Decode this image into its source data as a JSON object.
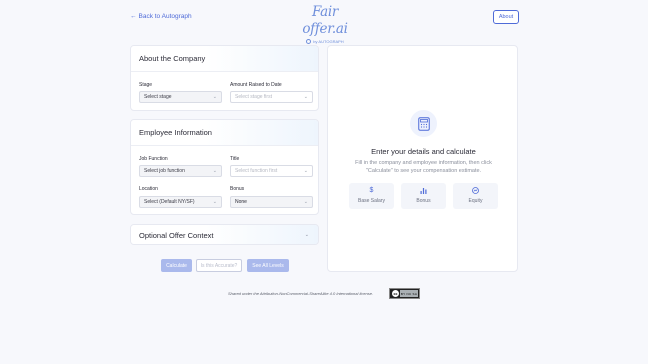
{
  "header": {
    "back_label": "Back to Autograph",
    "logo_text": "Fair offer.ai",
    "logo_sub": "by AUTOGRAPH",
    "about_label": "About"
  },
  "company": {
    "title": "About the Company",
    "stage_label": "Stage",
    "stage_value": "Select stage",
    "amount_label": "Amount Raised to Date",
    "amount_value": "Select stage first"
  },
  "employee": {
    "title": "Employee Information",
    "job_label": "Job Function",
    "job_value": "Select job function",
    "title_label": "Title",
    "title_value": "Select function first",
    "location_label": "Location",
    "location_value": "Select (Default NY/SF)",
    "bonus_label": "Bonus",
    "bonus_value": "None"
  },
  "optional": {
    "title": "Optional Offer Context"
  },
  "actions": {
    "calculate": "Calculate",
    "accurate": "Is this Accurate?",
    "levels": "See All Levels"
  },
  "result": {
    "title": "Enter your details and calculate",
    "description": "Fill in the company and employee information, then click \"Calculate\" to see your compensation estimate.",
    "metrics": [
      {
        "label": "Base Salary",
        "icon": "dollar-icon"
      },
      {
        "label": "Bonus",
        "icon": "bar-chart-icon"
      },
      {
        "label": "Equity",
        "icon": "chart-circle-icon"
      }
    ]
  },
  "footer": {
    "license_text": "Shared under the Attribution-NonCommercial-ShareAlike 4.0 International license.",
    "badge_text": "BY NC SA"
  },
  "colors": {
    "accent": "#4f6bd8",
    "button_disabled": "#aab9ec",
    "logo": "#6f8fdb"
  }
}
